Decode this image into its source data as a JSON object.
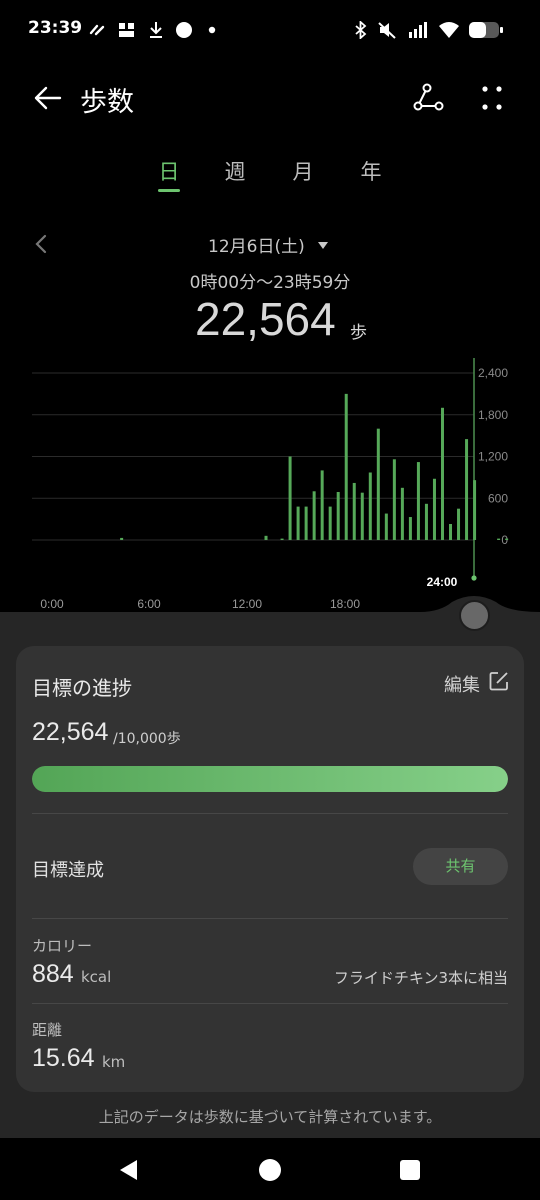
{
  "status_bar": {
    "time": "23:39",
    "icons": [
      "data-saver-icon",
      "lte-icon",
      "download-icon",
      "circle-icon",
      "dot-icon",
      "bluetooth-icon",
      "mute-icon",
      "signal-icon",
      "wifi-icon",
      "battery-icon"
    ]
  },
  "app_bar": {
    "title": "歩数"
  },
  "tabs": [
    {
      "label": "日",
      "active": true
    },
    {
      "label": "週",
      "active": false
    },
    {
      "label": "月",
      "active": false
    },
    {
      "label": "年",
      "active": false
    }
  ],
  "date": {
    "label": "12月6日(土)",
    "range": "0時00分～23時59分",
    "steps": "22,564",
    "steps_unit": "歩"
  },
  "chart_data": {
    "type": "bar",
    "x": [
      "0:00",
      "0:30",
      "1:00",
      "1:30",
      "2:00",
      "2:30",
      "3:00",
      "3:30",
      "4:00",
      "4:30",
      "5:00",
      "5:30",
      "6:00",
      "6:30",
      "7:00",
      "7:30",
      "8:00",
      "8:30",
      "9:00",
      "9:30",
      "10:00",
      "10:30",
      "11:00",
      "11:30",
      "12:00",
      "12:30",
      "13:00",
      "13:30",
      "14:00",
      "14:30",
      "15:00",
      "15:30",
      "16:00",
      "16:30",
      "17:00",
      "17:30",
      "18:00",
      "18:30",
      "19:00",
      "19:30",
      "20:00",
      "20:30",
      "21:00",
      "21:30",
      "22:00",
      "22:30",
      "23:00",
      "23:30"
    ],
    "values": [
      0,
      0,
      0,
      0,
      0,
      0,
      30,
      0,
      0,
      0,
      0,
      0,
      0,
      0,
      0,
      0,
      0,
      0,
      0,
      0,
      0,
      0,
      0,
      0,
      60,
      0,
      20,
      1200,
      480,
      480,
      700,
      1000,
      480,
      690,
      2100,
      820,
      680,
      970,
      1600,
      380,
      1160,
      750,
      330,
      1120,
      520,
      880,
      1900,
      230,
      450,
      1450,
      860,
      0,
      0,
      20,
      20
    ],
    "x_tick_labels": [
      "0:00",
      "6:00",
      "12:00",
      "18:00",
      "24:00"
    ],
    "y_tick_labels": [
      "2,400",
      "1,800",
      "1,200",
      "600",
      "0"
    ],
    "ylim": [
      0,
      2400
    ],
    "grid": true,
    "color": "#56a959"
  },
  "goal_card": {
    "title": "目標の進捗",
    "edit_label": "編集",
    "current": "22,564",
    "goal": "/10,000歩",
    "progress_fraction": 1.0,
    "achieved_label": "目標達成",
    "share_label": "共有",
    "calories_label": "カロリー",
    "calories_value": "884",
    "calories_unit": "kcal",
    "calories_equiv": "フライドチキン3本に相当",
    "distance_label": "距離",
    "distance_value": "15.64",
    "distance_unit": "km"
  },
  "footnote": "上記のデータは歩数に基づいて計算されています。",
  "colors": {
    "accent": "#6dc46f",
    "bar": "#56a959",
    "card": "#333333",
    "sheet": "#262626"
  }
}
